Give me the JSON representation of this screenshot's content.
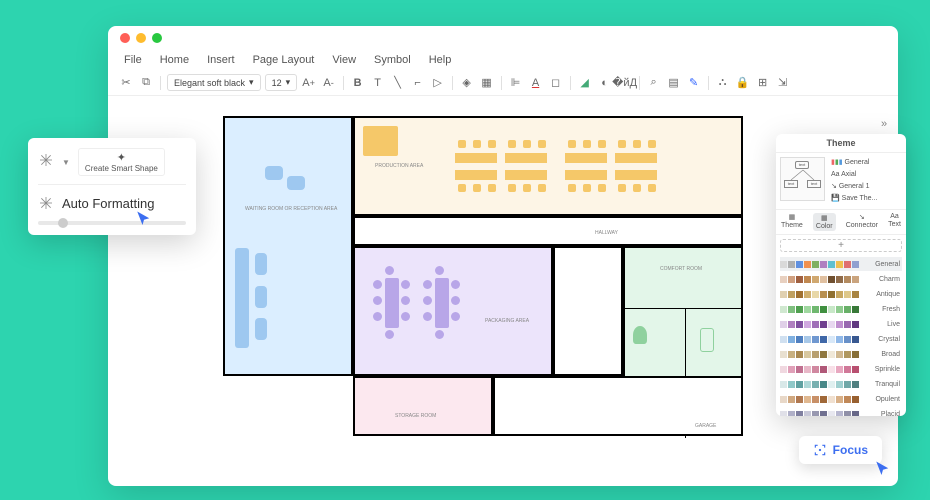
{
  "menubar": [
    "File",
    "Home",
    "Insert",
    "Page Layout",
    "View",
    "Symbol",
    "Help"
  ],
  "toolbar": {
    "font": "Elegant soft black",
    "size": "12"
  },
  "popup1": {
    "smart_shape": "Create Smart Shape",
    "auto_format": "Auto Formatting"
  },
  "rooms": {
    "waiting": "WAITING ROOM  OR RECEPTION AREA",
    "production": "PRODUCTION AREA",
    "hallway": "HALLWAY",
    "packaging": "PACKAGING AREA",
    "storage": "STORAGE ROOM",
    "comfort": "COMFORT ROOM",
    "garage": "GARAGE"
  },
  "theme": {
    "title": "Theme",
    "list": [
      "General",
      "Axial",
      "General 1",
      "Save The..."
    ],
    "tabs": [
      "Theme",
      "Color",
      "Connector",
      "Text"
    ],
    "colors": [
      "General",
      "Charm",
      "Antique",
      "Fresh",
      "Live",
      "Crystal",
      "Broad",
      "Sprinkle",
      "Tranquil",
      "Opulent",
      "Placid"
    ]
  },
  "focus": {
    "label": "Focus"
  },
  "color_swatches": [
    [
      "#d9d9d9",
      "#b0b0b0",
      "#6090e0",
      "#f09050",
      "#80b060",
      "#b080c0",
      "#60c0d0",
      "#f0c050",
      "#e07070",
      "#90a0d0"
    ],
    [
      "#e8d0c0",
      "#d0a080",
      "#a06040",
      "#c08850",
      "#d0a870",
      "#e0c0a0",
      "#705030",
      "#8f6b4a",
      "#b38b60",
      "#caa47e"
    ],
    [
      "#e0d0b0",
      "#c0a060",
      "#a07030",
      "#d0b070",
      "#e8d8a8",
      "#b89050",
      "#907030",
      "#c8a862",
      "#dec88a",
      "#a88440"
    ],
    [
      "#d0e8d0",
      "#80c080",
      "#50a050",
      "#a0d8a0",
      "#70b870",
      "#409040",
      "#c8e8c8",
      "#90cc90",
      "#68b068",
      "#387838"
    ],
    [
      "#e0d0e8",
      "#b080c0",
      "#8050a0",
      "#d0a8e0",
      "#a070b8",
      "#704090",
      "#e8d8f0",
      "#c090d0",
      "#9868b0",
      "#603880"
    ],
    [
      "#d0e0f0",
      "#80b0e0",
      "#5080c0",
      "#a8c8e8",
      "#7098d0",
      "#4068a8",
      "#d8e8f8",
      "#90b8e8",
      "#6890c8",
      "#385890"
    ],
    [
      "#e8e0d0",
      "#c8b080",
      "#a88850",
      "#d8c8a0",
      "#b8a070",
      "#907840",
      "#f0e8d8",
      "#d0b890",
      "#b09860",
      "#887038"
    ],
    [
      "#f0d8e0",
      "#e0a0b8",
      "#c07090",
      "#e8b8c8",
      "#d088a0",
      "#b05878",
      "#f8e0e8",
      "#e8a8c0",
      "#d07898",
      "#b85070"
    ],
    [
      "#d8e8e8",
      "#90c8c8",
      "#60a0a0",
      "#b0d8d8",
      "#78b0b0",
      "#488888",
      "#e0f0f0",
      "#a0d0d0",
      "#70a8a8",
      "#508080"
    ],
    [
      "#e8d8c8",
      "#d0a880",
      "#b07850",
      "#e0b890",
      "#c89068",
      "#a06838",
      "#f0e0d0",
      "#d8b088",
      "#c08858",
      "#986030"
    ],
    [
      "#e0e0e8",
      "#b0b0c8",
      "#8080a0",
      "#c8c8d8",
      "#9898b0",
      "#707090",
      "#e8e8f0",
      "#b8b8d0",
      "#9090a8",
      "#686888"
    ]
  ]
}
